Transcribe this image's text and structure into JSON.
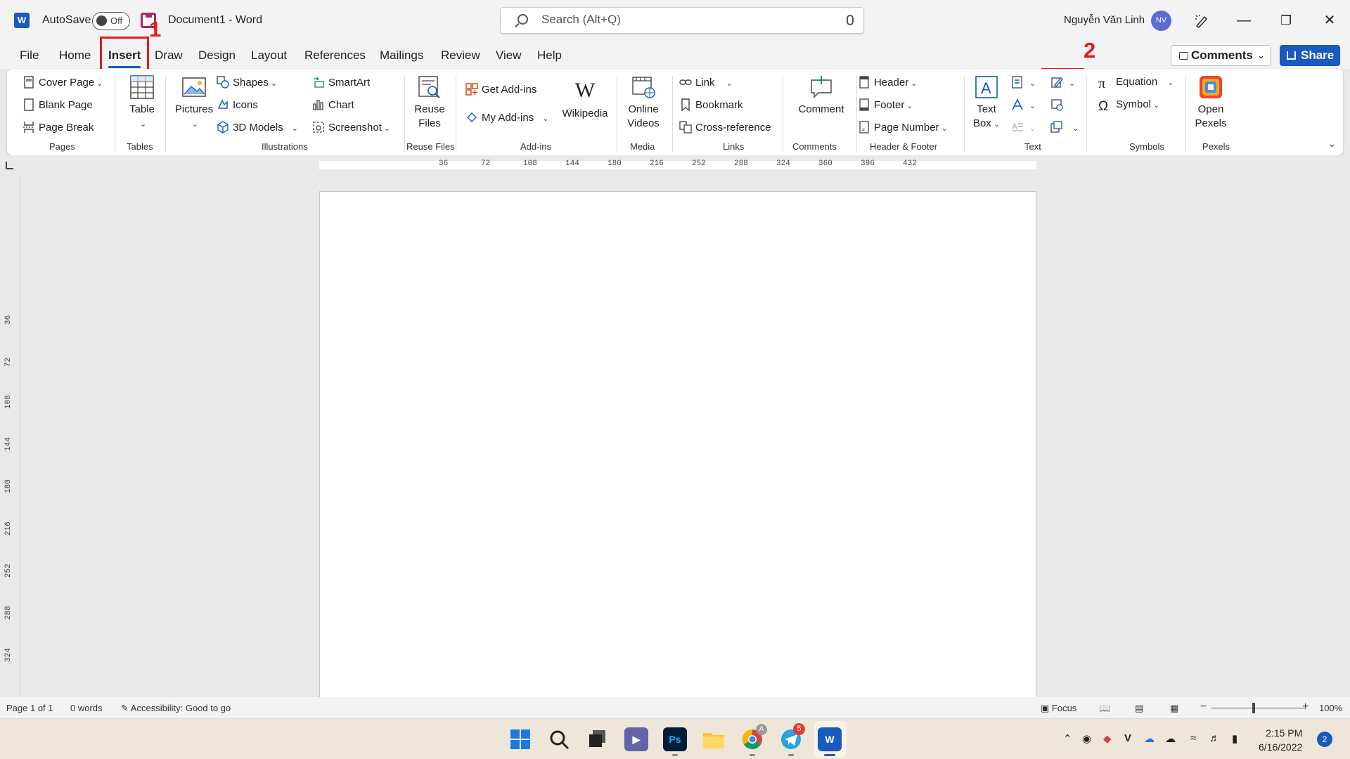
{
  "titlebar": {
    "autosave_label": "AutoSave",
    "autosave_state": "Off",
    "doc_title": "Document1  -  Word",
    "search_placeholder": "Search (Alt+Q)",
    "user_name": "Nguyễn Văn Linh",
    "user_initials": "NV"
  },
  "tabs": [
    "File",
    "Home",
    "Insert",
    "Draw",
    "Design",
    "Layout",
    "References",
    "Mailings",
    "Review",
    "View",
    "Help"
  ],
  "active_tab": "Insert",
  "annotations": {
    "one": "1",
    "two": "2"
  },
  "actions": {
    "comments": "Comments",
    "share": "Share"
  },
  "ribbon": {
    "pages": {
      "cover_page": "Cover Page",
      "blank_page": "Blank Page",
      "page_break": "Page Break",
      "label": "Pages"
    },
    "tables": {
      "table": "Table",
      "label": "Tables"
    },
    "illustrations": {
      "pictures": "Pictures",
      "shapes": "Shapes",
      "icons": "Icons",
      "models": "3D Models",
      "smartart": "SmartArt",
      "chart": "Chart",
      "screenshot": "Screenshot",
      "label": "Illustrations"
    },
    "reuse": {
      "reuse_files_1": "Reuse",
      "reuse_files_2": "Files",
      "label": "Reuse Files"
    },
    "addins": {
      "get_addins": "Get Add-ins",
      "my_addins": "My Add-ins",
      "wikipedia": "Wikipedia",
      "label": "Add-ins"
    },
    "media": {
      "online_videos_1": "Online",
      "online_videos_2": "Videos",
      "label": "Media"
    },
    "links": {
      "link": "Link",
      "bookmark": "Bookmark",
      "cross_reference": "Cross-reference",
      "label": "Links"
    },
    "comments": {
      "comment": "Comment",
      "label": "Comments"
    },
    "header_footer": {
      "header": "Header",
      "footer": "Footer",
      "page_number": "Page Number",
      "label": "Header & Footer"
    },
    "text": {
      "text_box_1": "Text",
      "text_box_2": "Box",
      "label": "Text"
    },
    "symbols": {
      "equation": "Equation",
      "symbol": "Symbol",
      "label": "Symbols"
    },
    "pexels": {
      "open_pexels_1": "Open",
      "open_pexels_2": "Pexels",
      "label": "Pexels"
    }
  },
  "ruler_h": [
    "36",
    "72",
    "108",
    "144",
    "180",
    "216",
    "252",
    "288",
    "324",
    "360",
    "396",
    "432"
  ],
  "ruler_v": [
    "36",
    "72",
    "108",
    "144",
    "180",
    "216",
    "252",
    "288",
    "324"
  ],
  "statusbar": {
    "page": "Page 1 of 1",
    "words": "0 words",
    "accessibility": "Accessibility: Good to go",
    "focus": "Focus",
    "zoom": "100%"
  },
  "taskbar": {
    "telegram_badge": "5",
    "chrome_badge": "A",
    "time": "2:15 PM",
    "date": "6/16/2022",
    "notifications": "2"
  },
  "colors": {
    "word_blue": "#185abd",
    "highlight_red": "#e41b1b"
  }
}
